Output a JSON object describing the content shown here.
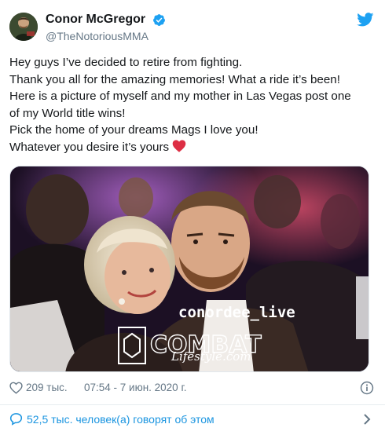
{
  "author": {
    "display_name": "Conor McGregor",
    "handle": "@TheNotoriousMMA",
    "verified": true
  },
  "tweet": {
    "lines": [
      "Hey guys I’ve decided to retire from fighting.",
      "Thank you all for the amazing memories! What a ride it’s been!",
      "Here is a picture of myself and my mother in Las Vegas post one",
      "of my World title wins!",
      "Pick the home of your dreams Mags I love you!",
      "Whatever you desire it’s yours"
    ],
    "trailing_emoji": "red-heart"
  },
  "media": {
    "watermark_handle": "conordee_live",
    "watermark_logo_top": "COMBAT",
    "watermark_logo_script": "Lifestyle.com"
  },
  "meta": {
    "likes": "209 тыс.",
    "timestamp": "07:54 - 7 июн. 2020 г."
  },
  "footer": {
    "conversation": "52,5 тыс. человек(а) говорят об этом"
  },
  "colors": {
    "twitter_blue": "#1da1f2",
    "link_blue": "#1b95e0",
    "secondary_text": "#657786",
    "heart_red": "#e0245e"
  },
  "icons": [
    "verified-badge-icon",
    "twitter-bird-icon",
    "red-heart-icon",
    "heart-outline-icon",
    "info-icon",
    "speech-bubble-icon",
    "chevron-right-icon"
  ]
}
